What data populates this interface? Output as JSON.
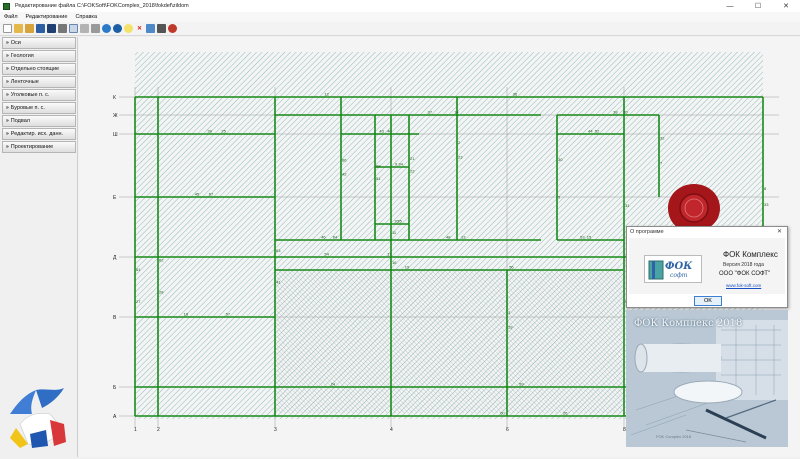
{
  "window": {
    "title": "Редактирование файла C:\\FOKSoft\\FOKComplex_2018\\fokdef\\zildom",
    "minimize_glyph": "—",
    "maximize_glyph": "☐",
    "close_glyph": "✕"
  },
  "menu": [
    "Файл",
    "Редактирование",
    "Справка"
  ],
  "toolbar": [
    "new-file-icon",
    "open-folder-icon",
    "open-icon",
    "save-icon",
    "save-as-icon",
    "print-icon",
    "copy-icon",
    "cut-icon",
    "wrench-icon",
    "globe-icon",
    "globe-2-icon",
    "lightbulb-icon",
    "delete-icon",
    "table-icon",
    "camera-icon",
    "sync-icon"
  ],
  "sidebar": {
    "chevron": "»",
    "items": [
      "Оси",
      "Геология",
      "Отдельно стоящие",
      "Ленточные",
      "Уголковые п. с.",
      "Буровые п. с.",
      "Подвал",
      "Редактир. исх. данн.",
      "Проектирование"
    ]
  },
  "plan": {
    "row_axes": [
      "К",
      "Ж",
      "Ш",
      "Е",
      "Д",
      "В",
      "Б",
      "А"
    ],
    "col_axes": [
      "1",
      "2",
      "3",
      "4",
      "6",
      "8"
    ],
    "member_labels": [
      "12",
      "14",
      "20",
      "25",
      "40",
      "52",
      "67",
      "64",
      "13",
      "15",
      "17",
      "19",
      "18",
      "24",
      "26",
      "27",
      "28",
      "41",
      "42",
      "51",
      "16",
      "22",
      "23",
      "29",
      "30",
      "31",
      "32",
      "33",
      "34",
      "35",
      "36",
      "37",
      "38",
      "39",
      "43",
      "44",
      "45",
      "46",
      "48",
      "53",
      "54",
      "56",
      "57",
      "59",
      "60",
      "61",
      "62",
      "63",
      "66",
      "68",
      "11",
      "21",
      "2",
      "3",
      "5",
      "6",
      "7",
      "8",
      "9",
      "10"
    ],
    "colors": {
      "beam": "#178a17",
      "hatch": "#3d8f8f",
      "paper": "#f4f4f4"
    }
  },
  "about_dialog": {
    "title": "О программе",
    "close_glyph": "✕",
    "logo_text": "ФОК",
    "logo_sub": "софт",
    "app_name": "ФОК Комплекс",
    "version": "Версия 2018 года",
    "company": "ООО \"ФОК СОФТ\"",
    "url": "www.fok-soft.com",
    "ok_label": "OK"
  },
  "splash": {
    "title": "ФОК Комплекс 2018",
    "footer": "FOK Complex 2018"
  }
}
